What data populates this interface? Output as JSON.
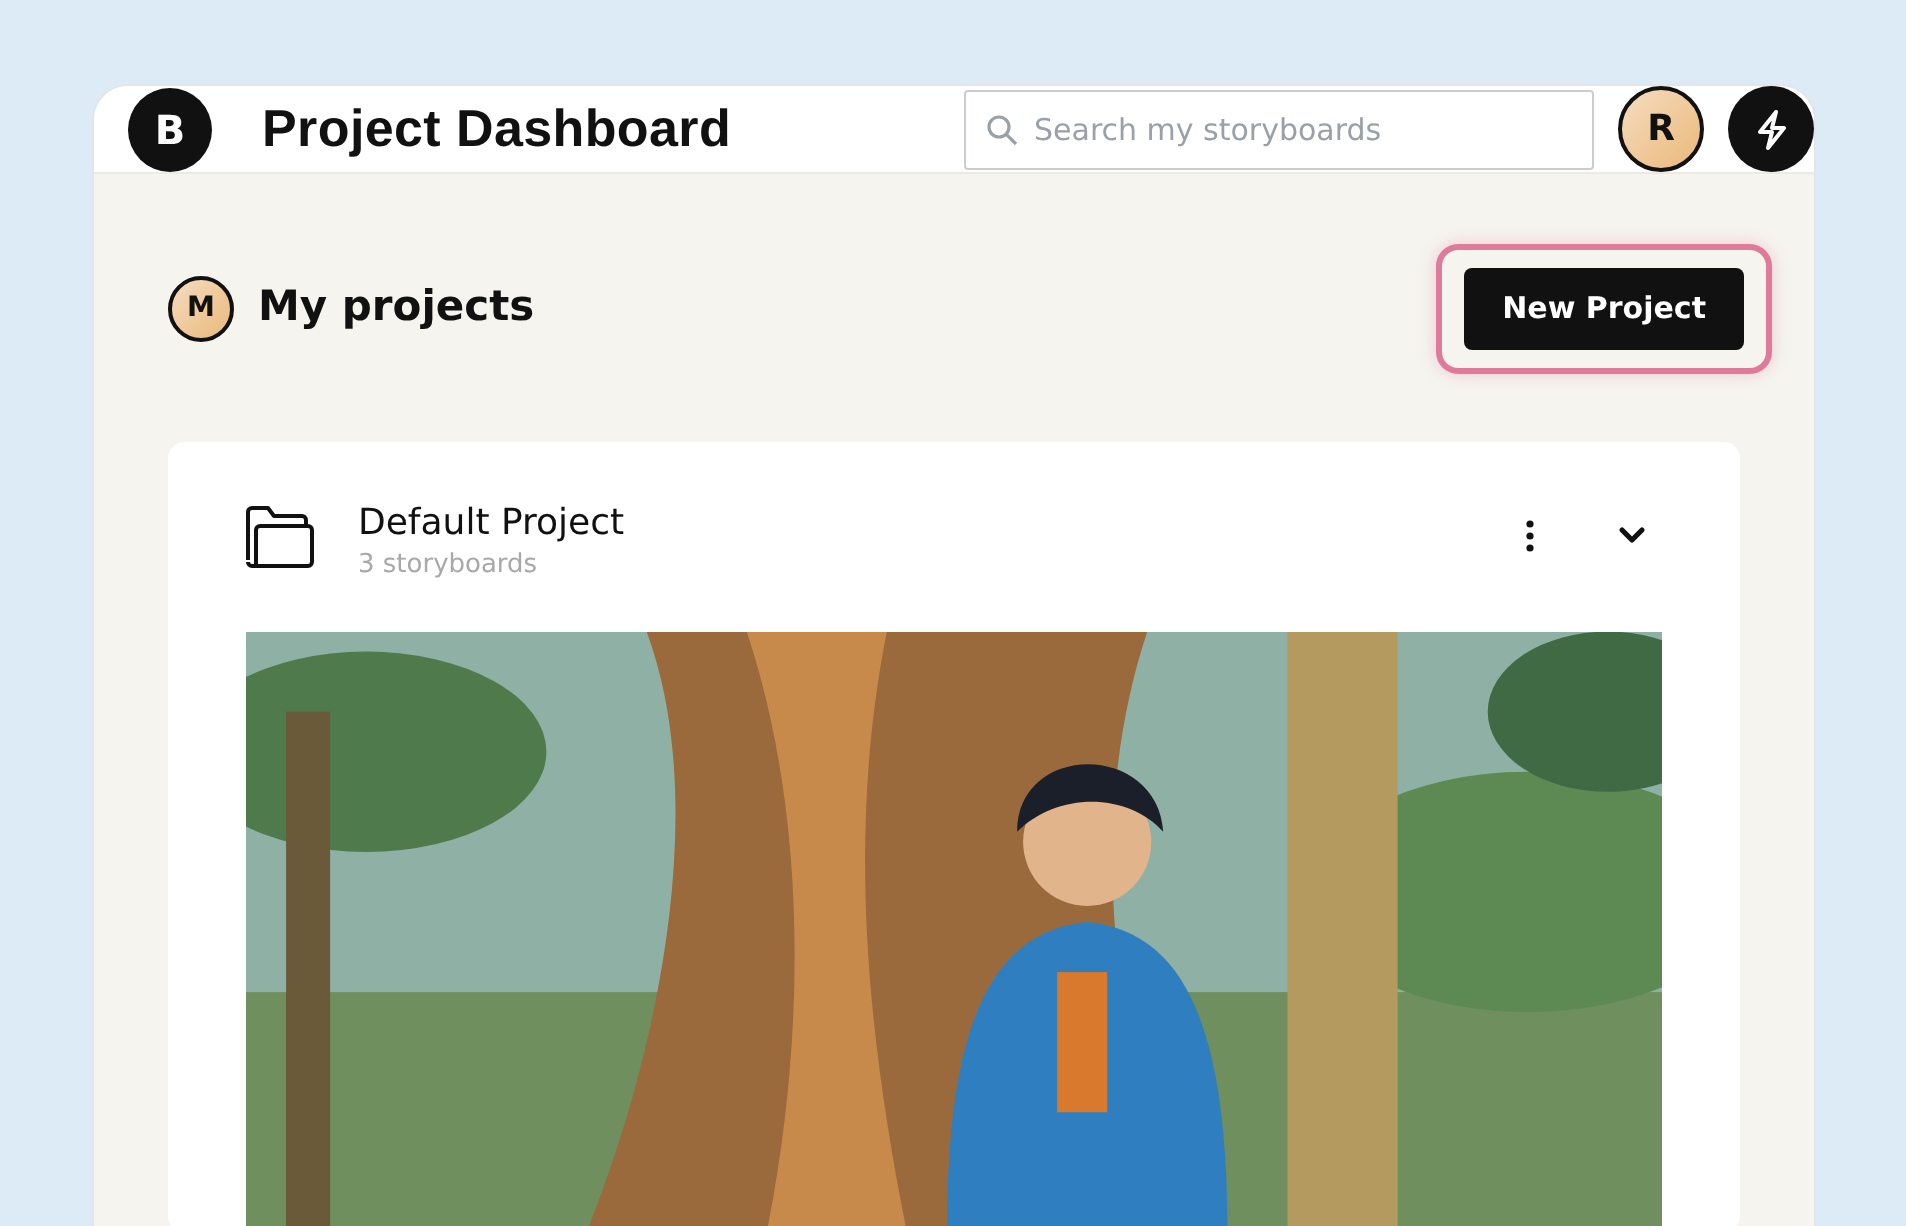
{
  "header": {
    "logo": "B",
    "title": "Project Dashboard",
    "search": {
      "placeholder": "Search my storyboards"
    },
    "avatar": "R"
  },
  "section": {
    "avatar": "M",
    "title": "My projects",
    "new_button": {
      "label": "New Project",
      "focused": true
    }
  },
  "projects": [
    {
      "name": "Default Project",
      "count": "3 storyboards",
      "expanded": true
    }
  ]
}
